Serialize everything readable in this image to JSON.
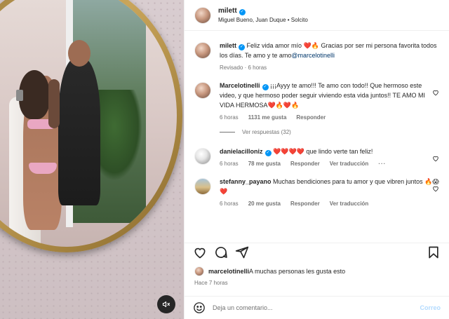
{
  "post": {
    "username": "milett",
    "collaborators_line": "Miguel Bueno, Juan Duque • Solcito"
  },
  "caption": {
    "username": "milett",
    "text": "Feliz vida amor mío ❤️🔥 Gracias por ser mi persona favorita todos los días. Te amo y te amo",
    "mention": "@marcelotinelli",
    "meta": "Revisado · 6 horas"
  },
  "comments": [
    {
      "username": "Marcelotinelli",
      "text": "¡¡¡Ayyy te amo!!! Te amo con todo!! Que hermoso este video, y que hermoso poder seguir viviendo esta vida juntos!! TE AMO MI VIDA HERMOSA❤️🔥❤️🔥",
      "time": "6 horas",
      "likes": "1131 me gusta",
      "reply": "Responder",
      "view_replies": "Ver respuestas (32)"
    },
    {
      "username": "danielacilloniz",
      "text": "❤️❤️❤️❤️ que lindo verte tan feliz!",
      "time": "6 horas",
      "likes": "78 me gusta",
      "reply": "Responder",
      "translate": "Ver traducción",
      "more": "···"
    },
    {
      "username": "stefanny_payano",
      "text": "Muchas bendiciones para tu amor y que vibren juntos 🔥😱❤️",
      "time": "6 horas",
      "likes": "20 me gusta",
      "reply": "Responder",
      "translate": "Ver traducción"
    }
  ],
  "likes_summary": {
    "username": "marcelotinelli",
    "text": "A muchas personas les gusta esto"
  },
  "posted_ago": "Hace 7 horas",
  "composer": {
    "placeholder": "Deja un comentario...",
    "post_label": "Correo"
  },
  "colors": {
    "verified": "#0095f6",
    "mention": "#00376b",
    "muted": "#737373",
    "post_disabled": "#b3dbff"
  }
}
